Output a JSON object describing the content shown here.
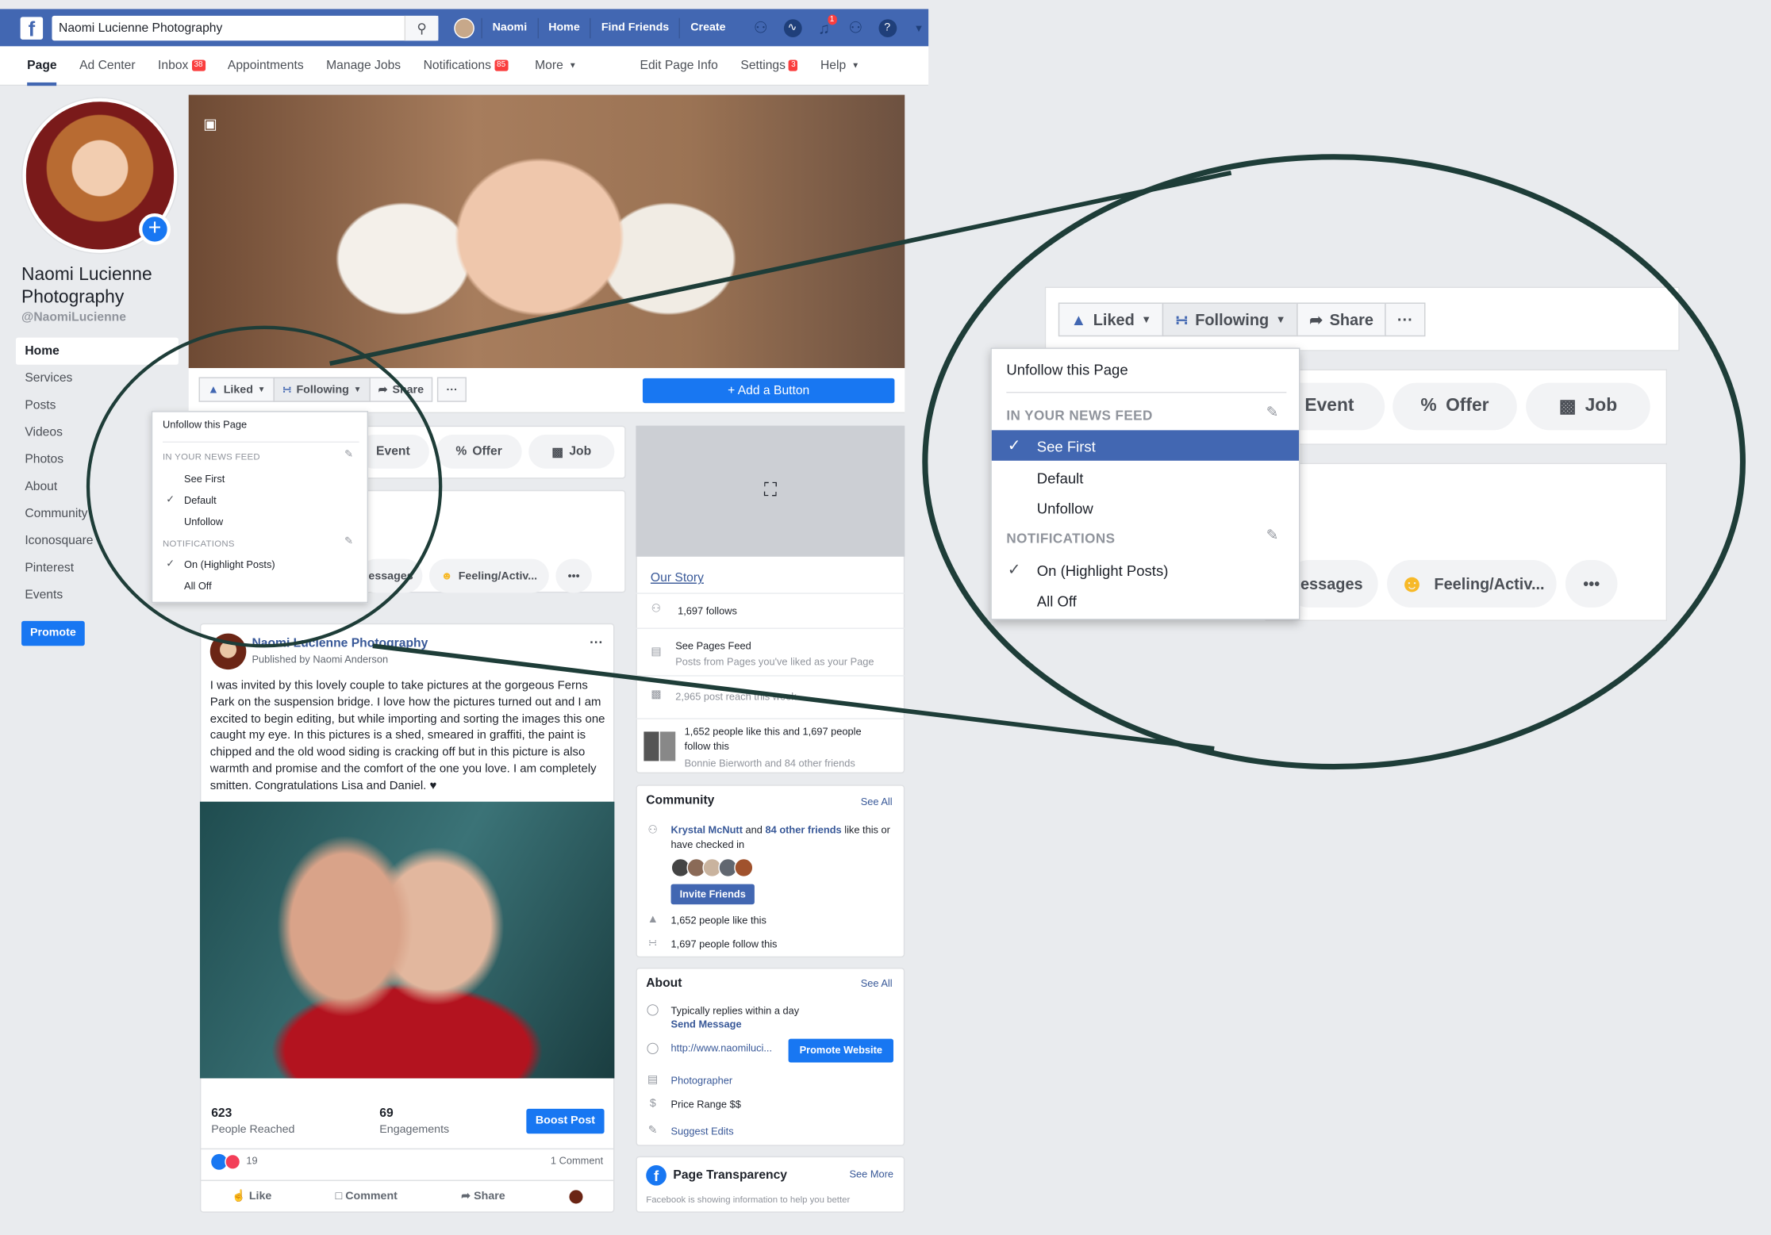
{
  "topbar": {
    "search_value": "Naomi Lucienne Photography",
    "user": "Naomi",
    "links": [
      "Home",
      "Find Friends",
      "Create"
    ],
    "notif_badge": "1"
  },
  "pagenav": {
    "page": "Page",
    "ad_center": "Ad Center",
    "inbox": "Inbox",
    "inbox_badge": "38",
    "appointments": "Appointments",
    "manage_jobs": "Manage Jobs",
    "notifications": "Notifications",
    "notifications_badge": "85",
    "more": "More",
    "edit_page_info": "Edit Page Info",
    "settings": "Settings",
    "settings_badge": "3",
    "help": "Help"
  },
  "profile": {
    "name": "Naomi Lucienne Photography",
    "handle": "@NaomiLucienne"
  },
  "sidenav": [
    "Home",
    "Services",
    "Posts",
    "Videos",
    "Photos",
    "About",
    "Community",
    "Iconosquare",
    "Pinterest",
    "Events"
  ],
  "promote": "Promote",
  "actions": {
    "liked": "Liked",
    "following": "Following",
    "share": "Share",
    "more": "···",
    "add_button": "Add a Button"
  },
  "dropdown": {
    "unfollow_page": "Unfollow this Page",
    "news_feed_head": "IN YOUR NEWS FEED",
    "see_first": "See First",
    "default": "Default",
    "unfollow": "Unfollow",
    "notifications_head": "NOTIFICATIONS",
    "on_highlight": "On (Highlight Posts)",
    "all_off": "All Off"
  },
  "create": {
    "event": "Event",
    "offer": "Offer",
    "job": "Job",
    "messages": "essages",
    "feeling": "Feeling/Activ...",
    "more": "•••"
  },
  "post": {
    "author": "Naomi Lucienne Photography",
    "published_by": "Published by Naomi Anderson",
    "text": "I was invited by this lovely couple to take pictures at the gorgeous Ferns Park on the suspension bridge. I love how the pictures turned out and I am excited to begin editing, but while importing and sorting the images this one caught my eye. In this pictures is a shed, smeared in graffiti, the paint is chipped and the old wood siding is cracking off but in this picture is also warmth and promise and the comfort of the one you love. I am completely smitten. Congratulations Lisa and Daniel. ♥",
    "reached_num": "623",
    "reached_lbl": "People Reached",
    "eng_num": "69",
    "eng_lbl": "Engagements",
    "boost": "Boost Post",
    "reactions": "19",
    "comments": "1 Comment",
    "like": "Like",
    "comment": "Comment",
    "share": "Share"
  },
  "right": {
    "our_story": "Our Story",
    "follows": "1,697 follows",
    "see_pages_feed": "See Pages Feed",
    "see_pages_sub": "Posts from Pages you've liked as your Page",
    "post_reach": "2,965 post reach this week",
    "likes_follow": "1,652 people like this and 1,697 people follow this",
    "friends_like": "Bonnie Bierworth and 84 other friends",
    "community": "Community",
    "see_all": "See All",
    "krystal": "Krystal McNutt",
    "and": "and",
    "other_friends": "84 other friends",
    "like_checked": "like this or have checked in",
    "invite": "Invite Friends",
    "like_count": "1,652 people like this",
    "follow_count": "1,697 people follow this",
    "about": "About",
    "replies": "Typically replies within a day",
    "send_message": "Send Message",
    "website": "http://www.naomiluci...",
    "promote_website": "Promote Website",
    "photographer": "Photographer",
    "price_range": "Price Range $$",
    "suggest_edits": "Suggest Edits",
    "transparency": "Page Transparency",
    "see_more": "See More",
    "transparency_sub": "Facebook is showing information to help you better"
  },
  "colors": {
    "fb_blue": "#4267b2",
    "button_blue": "#1877f2",
    "ellipse": "#1e3d38"
  }
}
